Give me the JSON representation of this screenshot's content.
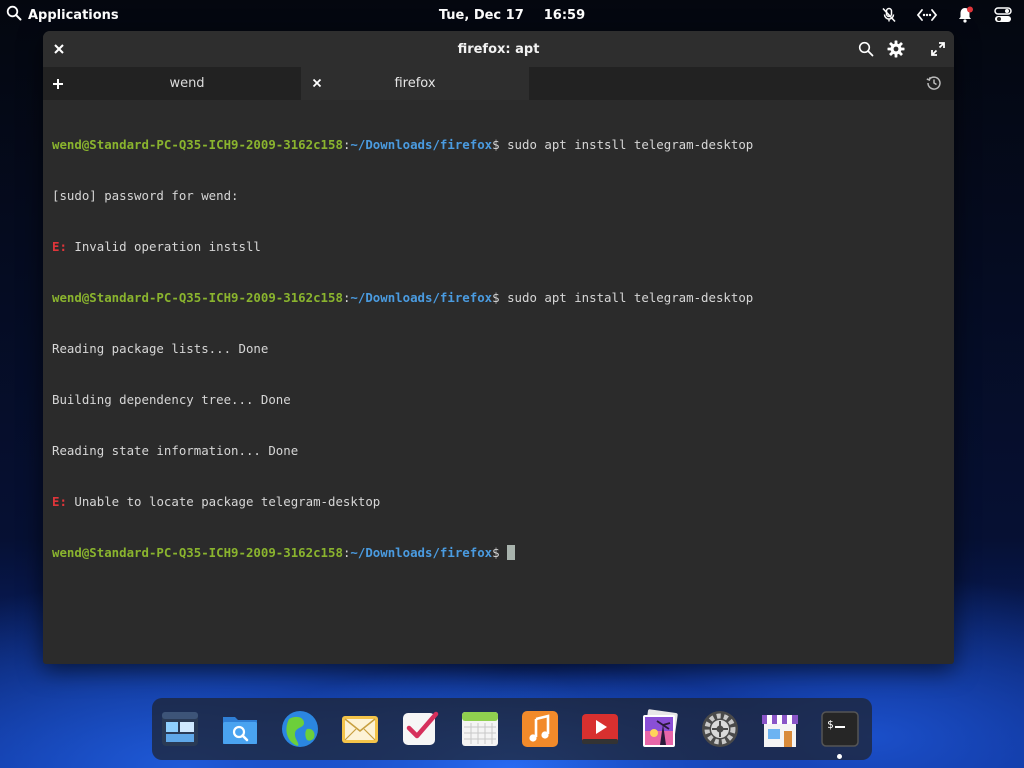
{
  "panel": {
    "applications_label": "Applications",
    "date": "Tue, Dec 17",
    "time": "16:59",
    "indicators": [
      "mic-muted-icon",
      "network-icon",
      "notifications-icon",
      "power-toggle-icon"
    ]
  },
  "window": {
    "title": "firefox: apt",
    "buttons": [
      "close-icon",
      "search-icon",
      "gear-icon",
      "fullscreen-icon"
    ],
    "tabs": [
      {
        "label": "wend",
        "active": false
      },
      {
        "label": "firefox",
        "active": true
      }
    ],
    "colors": {
      "user": "#8ab42e",
      "path": "#4a9be0",
      "error": "#e0353a",
      "text": "#d6d6d6",
      "bg": "#2b2b2b"
    }
  },
  "terminal": {
    "user_host": "wend@Standard-PC-Q35-ICH9-2009-3162c158",
    "sep": ":",
    "path": "~/Downloads/firefox",
    "prompt_char": "$",
    "cmd1": " sudo apt instsll telegram-desktop",
    "out1": "[sudo] password for wend:",
    "err_label": "E:",
    "err1": " Invalid operation instsll",
    "cmd2": " sudo apt install telegram-desktop",
    "out2": "Reading package lists... Done",
    "out3": "Building dependency tree... Done",
    "out4": "Reading state information... Done",
    "err2": " Unable to locate package telegram-desktop",
    "cmd3": " "
  },
  "dock": {
    "items": [
      "multitasking-view-icon",
      "files-icon",
      "web-browser-icon",
      "mail-icon",
      "tasks-icon",
      "calendar-icon",
      "music-icon",
      "videos-icon",
      "photos-icon",
      "system-settings-icon",
      "appcenter-icon",
      "terminal-icon"
    ]
  }
}
